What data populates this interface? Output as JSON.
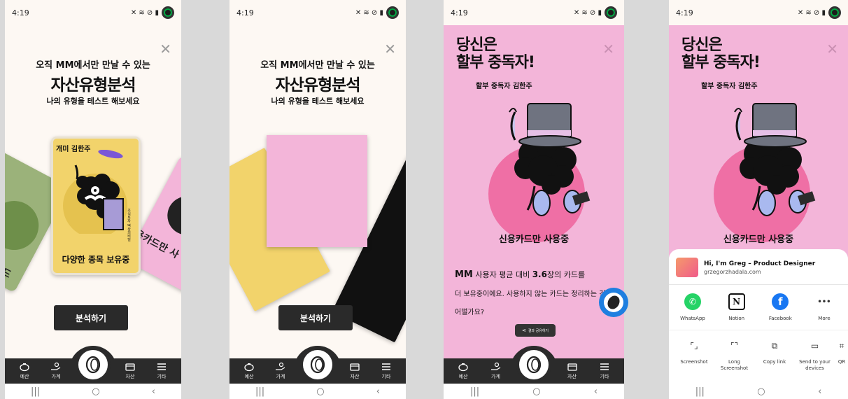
{
  "status": {
    "time": "4:19",
    "icons": "✕ ≋ ⊘ ▮"
  },
  "intro": {
    "line1": "오직 MM에서만 만날 수 있는",
    "line2": "자산유형분석",
    "line3": "나의 유형을 테스트 해보세요",
    "cta": "분석하기",
    "card_name": "개미 김한주",
    "card_caption": "다양한 종목 보유중",
    "left_card_text": "랑 카드 보",
    "right_card_text": "용카드만 사",
    "book_text": "주식투자 떡상의비밀"
  },
  "result": {
    "title_line1": "당신은",
    "title_line2": "할부 중독자!",
    "subtitle": "할부 중독자 김한주",
    "caption": "신용카드만 사용중",
    "body_brand": "MM",
    "body_pre": " 사용자 평균 대비 ",
    "body_num": "3.6",
    "body_post": "장의 카드를",
    "body_line2": "더 보유중이에요. 사용하지 않는 카드는 정리하는 건",
    "body_line3": "어떨가요?",
    "share_chip": "결과 공유하기"
  },
  "tabs": [
    {
      "label": "예산",
      "icon": "piggy-bank-icon"
    },
    {
      "label": "가계",
      "icon": "hand-coins-icon"
    },
    {
      "label": "자산",
      "icon": "wallet-icon"
    },
    {
      "label": "기타",
      "icon": "menu-icon"
    }
  ],
  "navbar": {
    "recents": "|||",
    "home": "○",
    "back": "‹"
  },
  "share_sheet": {
    "title": "Hi, I'm Greg – Product Designer",
    "url": "grzegorzhadala.com",
    "apps": [
      {
        "label": "WhatsApp",
        "glyph": "✆",
        "color": "#25d366"
      },
      {
        "label": "Notion",
        "glyph": "N",
        "color": "#ffffff"
      },
      {
        "label": "Facebook",
        "glyph": "f",
        "color": "#1877f2"
      },
      {
        "label": "More",
        "glyph": "•••",
        "color": "#ffffff"
      }
    ],
    "actions": [
      {
        "label": "Screenshot",
        "glyph": "⌜⌟"
      },
      {
        "label": "Long Screenshot",
        "glyph": "⌜⌝"
      },
      {
        "label": "Copy link",
        "glyph": "⧉"
      },
      {
        "label": "Send to your devices",
        "glyph": "▭"
      },
      {
        "label": "QR",
        "glyph": "⌗"
      }
    ]
  },
  "colors": {
    "cream": "#fdf8f3",
    "pink": "#f3b5d9",
    "yellow": "#f2d36b",
    "green": "#9bb27a",
    "dark": "#2b2b2b"
  }
}
